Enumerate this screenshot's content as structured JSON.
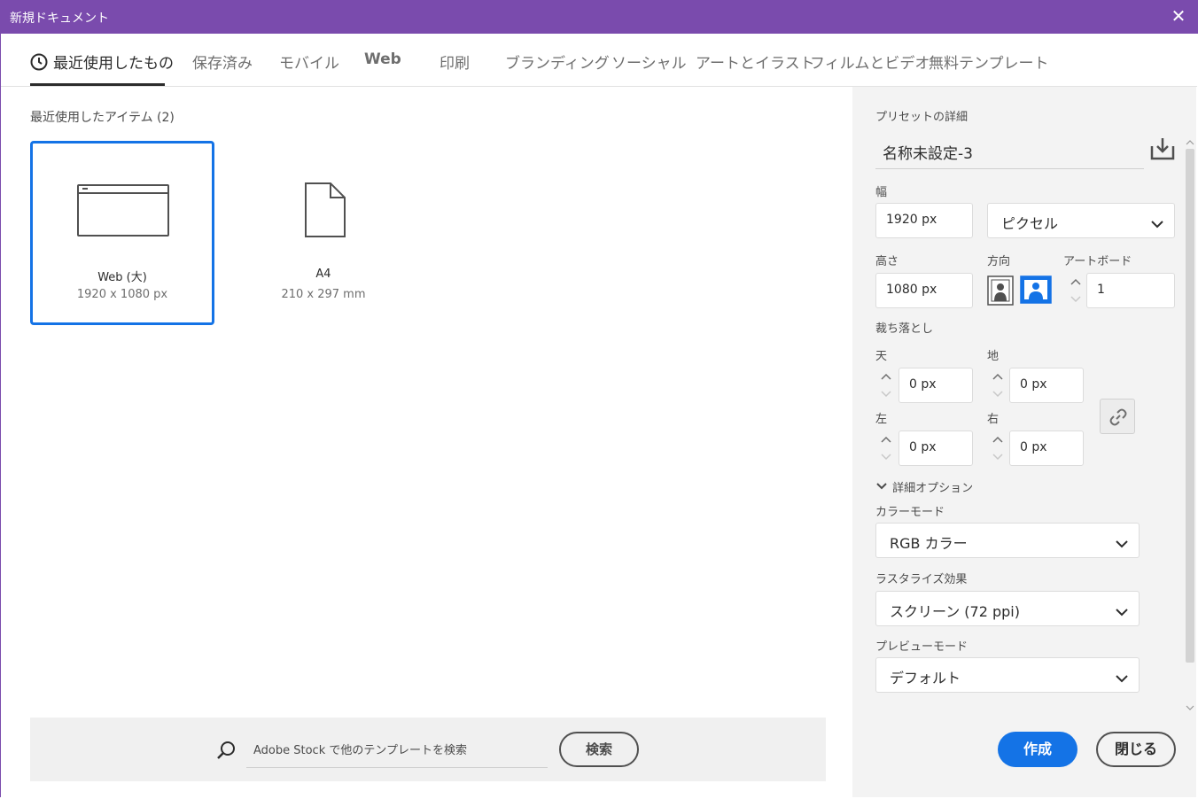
{
  "window": {
    "title": "新規ドキュメント"
  },
  "tabs": [
    {
      "label": "最近使用したもの"
    },
    {
      "label": "保存済み"
    },
    {
      "label": "モバイル"
    },
    {
      "label": "Web"
    },
    {
      "label": "印刷"
    },
    {
      "label": "ブランディング"
    },
    {
      "label": "ソーシャル"
    },
    {
      "label": "アートとイラスト"
    },
    {
      "label": "フィルムとビデオ"
    },
    {
      "label": "無料テンプレート"
    }
  ],
  "recent": {
    "title": "最近使用したアイテム (2)",
    "items": [
      {
        "name": "Web (大)",
        "size": "1920 x 1080 px",
        "icon": "browser-window-icon",
        "selected": true
      },
      {
        "name": "A4",
        "size": "210 x 297 mm",
        "icon": "document-icon",
        "selected": false
      }
    ]
  },
  "search": {
    "placeholder": "Adobe Stock で他のテンプレートを検索",
    "button": "検索"
  },
  "preset": {
    "header": "プリセットの詳細",
    "name": "名称未設定-3",
    "width_label": "幅",
    "width_value": "1920 px",
    "unit": "ピクセル",
    "height_label": "高さ",
    "height_value": "1080 px",
    "orientation_label": "方向",
    "artboard_label": "アートボード",
    "artboard_value": "1",
    "bleed_label": "裁ち落とし",
    "bleed": {
      "top_label": "天",
      "top": "0 px",
      "bottom_label": "地",
      "bottom": "0 px",
      "left_label": "左",
      "left": "0 px",
      "right_label": "右",
      "right": "0 px"
    },
    "advanced_label": "詳細オプション",
    "color_mode_label": "カラーモード",
    "color_mode": "RGB カラー",
    "raster_label": "ラスタライズ効果",
    "raster": "スクリーン (72 ppi)",
    "preview_label": "プレビューモード",
    "preview": "デフォルト"
  },
  "actions": {
    "create": "作成",
    "close": "閉じる"
  },
  "colors": {
    "titlebar": "#7a4bad",
    "accent": "#1473e6"
  }
}
